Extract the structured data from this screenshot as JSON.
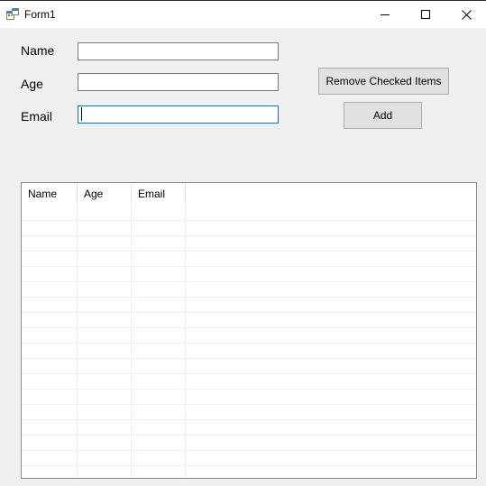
{
  "window": {
    "title": "Form1",
    "icon": "form-app-icon",
    "controls": [
      "minimize-icon",
      "maximize-icon",
      "close-icon"
    ]
  },
  "form": {
    "name_label": "Name",
    "age_label": "Age",
    "email_label": "Email",
    "name_value": "",
    "age_value": "",
    "email_value": ""
  },
  "buttons": {
    "remove_checked": "Remove Checked Items",
    "add": "Add"
  },
  "listview": {
    "columns": [
      "Name",
      "Age",
      "Email"
    ],
    "rows": []
  },
  "colors": {
    "window_bg": "#f0f0f0",
    "focus_border": "#0078d7",
    "button_bg": "#e1e1e1"
  }
}
